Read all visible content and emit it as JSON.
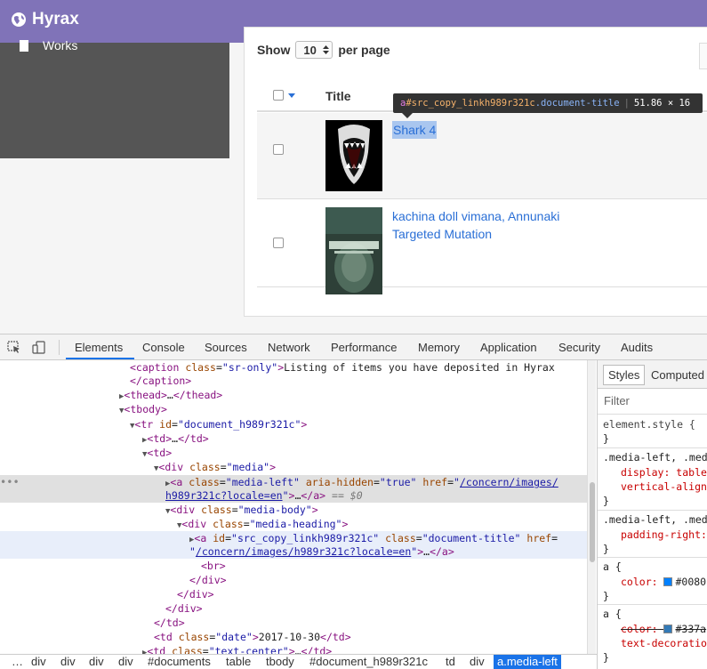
{
  "app": {
    "title": "Hyrax"
  },
  "sidebar": {
    "works_label": "Works"
  },
  "listing": {
    "show_label": "Show",
    "per_page_value": "10",
    "per_page_suffix": "per page",
    "column_title": "Title",
    "rows": [
      {
        "title": "Shark 4",
        "selected": true
      },
      {
        "title": "kachina doll vimana, Annunaki Targeted Mutation",
        "selected": false
      }
    ]
  },
  "tooltip": {
    "tag": "a",
    "id": "#src_copy_linkh989r321c",
    "cls": ".document-title",
    "size": "51.86 × 16"
  },
  "devtools": {
    "tabs": [
      "Elements",
      "Console",
      "Sources",
      "Network",
      "Performance",
      "Memory",
      "Application",
      "Security",
      "Audits"
    ],
    "active_tab": "Elements",
    "dom_lines": {
      "l0": "Listing of items you have deposited in Hyrax",
      "id_doc": "\"document_h989r321c\"",
      "cls_media": "\"media\"",
      "cls_media_left": "\"media-left\"",
      "aria_true": "\"true\"",
      "href1a": "/concern/images/",
      "href1b": "h989r321c?locale=en",
      "eq": "== $0",
      "cls_media_body": "\"media-body\"",
      "cls_media_heading": "\"media-heading\"",
      "id_link": "\"src_copy_linkh989r321c\"",
      "cls_doc_title": "\"document-title\"",
      "href2": "/concern/images/h989r321c?locale=en",
      "cls_date": "\"date\"",
      "date_value": "2017-10-30",
      "cls_text_center": "\"text-center\""
    },
    "styles": {
      "tab_styles": "Styles",
      "tab_computed": "Computed",
      "filter_placeholder": "Filter",
      "element_style": "element.style {",
      "sel1": ".media-left, .med",
      "p1a": "display: table",
      "p1b": "vertical-align",
      "sel2": ".media-left, .med",
      "p2": "padding-right:",
      "sel3": "a {",
      "p3_name": "color:",
      "p3_val": "#0080",
      "p3_color": "#0080ff",
      "sel4": "a {",
      "p4_name": "color:",
      "p4_val": "#337a",
      "p4_color": "#337ab7",
      "p4b": "text-decoratio"
    },
    "breadcrumbs": [
      "div",
      "div",
      "div",
      "div",
      "#documents",
      "table",
      "tbody",
      "#document_h989r321c",
      "td",
      "div",
      "a.media-left"
    ]
  }
}
